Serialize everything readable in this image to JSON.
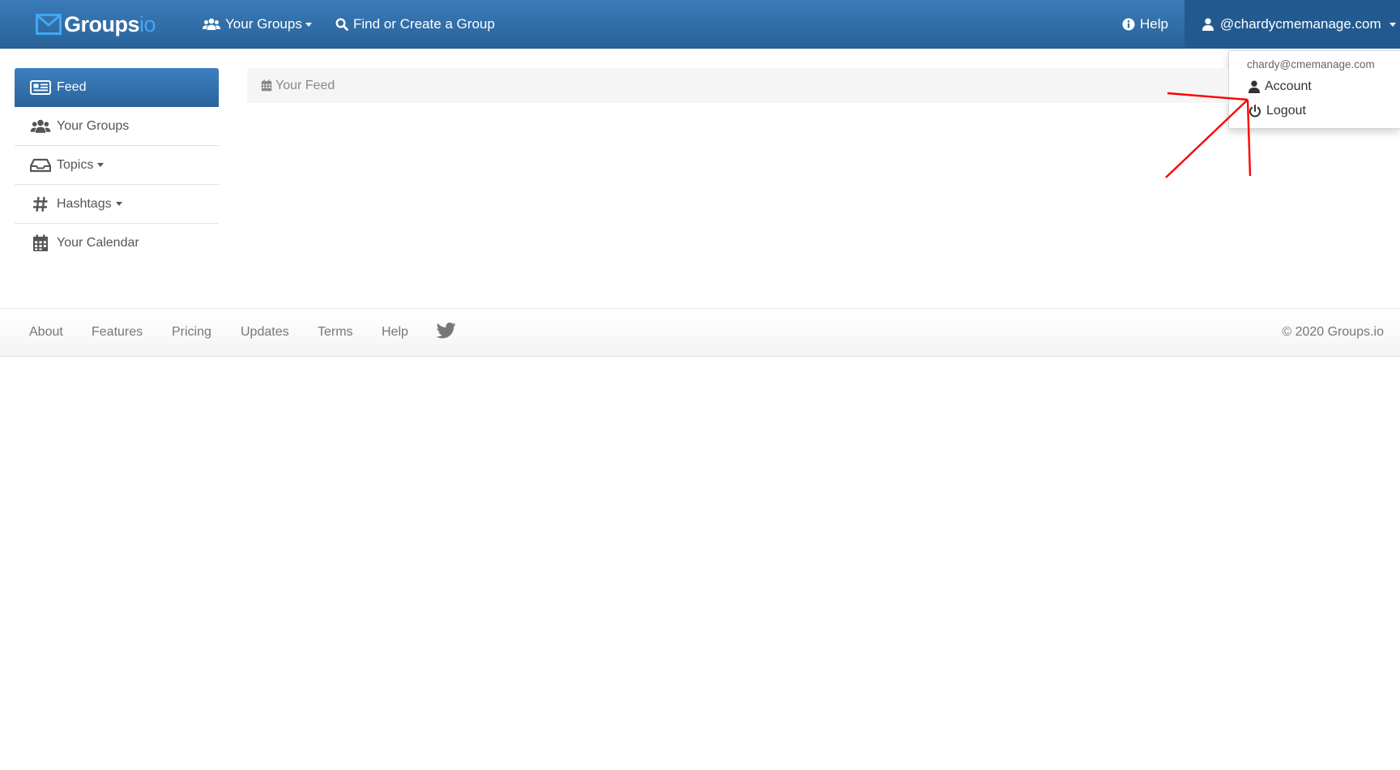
{
  "navbar": {
    "brand": {
      "name": "Groups",
      "suffix": "io"
    },
    "your_groups_label": "Your Groups",
    "find_create_label": "Find or Create a Group",
    "help_label": "Help",
    "account_label": "@chardycmemanage.com"
  },
  "dropdown": {
    "email": "chardy@cmemanage.com",
    "account_label": "Account",
    "logout_label": "Logout"
  },
  "sidebar": {
    "items": [
      {
        "label": "Feed",
        "icon": "newspaper-icon",
        "active": true
      },
      {
        "label": "Your Groups",
        "icon": "users-icon"
      },
      {
        "label": "Topics",
        "icon": "inbox-icon",
        "caret": true
      },
      {
        "label": "Hashtags",
        "icon": "hashtag-icon",
        "caret": true
      },
      {
        "label": "Your Calendar",
        "icon": "calendar-icon"
      }
    ]
  },
  "feed": {
    "title": "Your Feed",
    "icon": "calendar-icon"
  },
  "footer": {
    "links": [
      "About",
      "Features",
      "Pricing",
      "Updates",
      "Terms",
      "Help"
    ],
    "twitter_icon": "twitter-icon",
    "copyright": "© 2020 Groups.io"
  },
  "colors": {
    "navbar": "#2f6ea8",
    "accent": "#3fa9f5",
    "annotation": "#ff0000"
  }
}
